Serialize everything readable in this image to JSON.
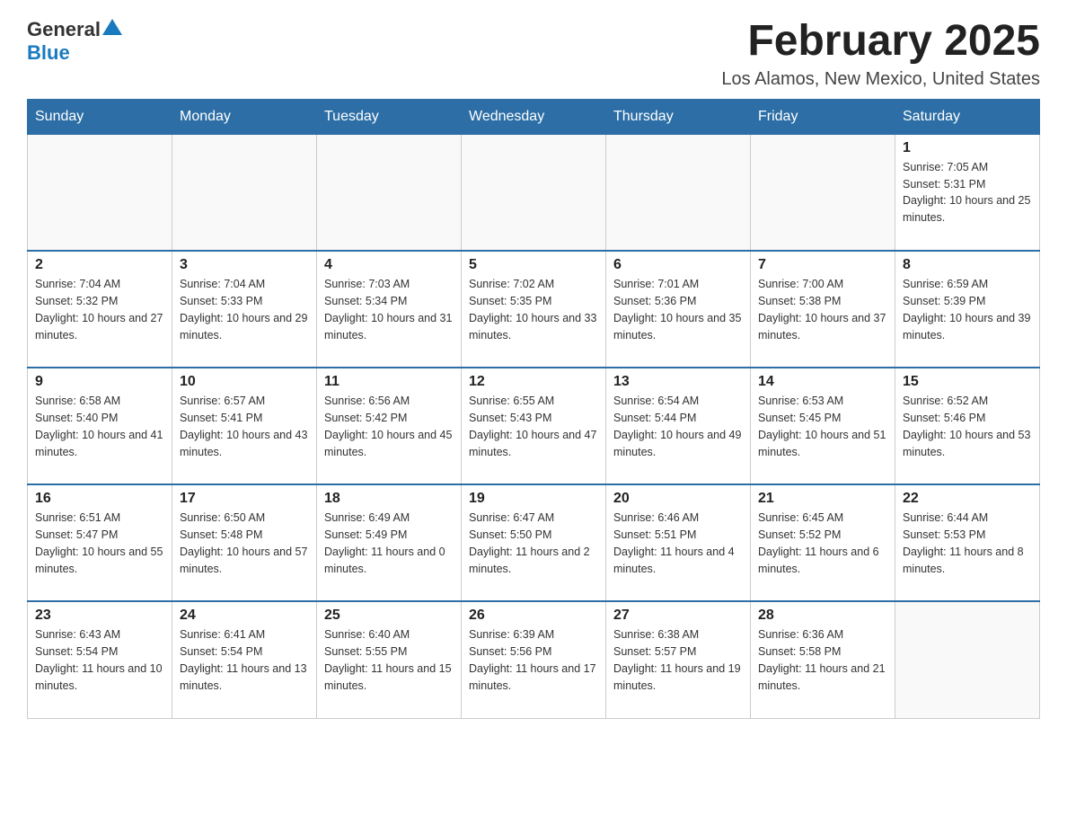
{
  "header": {
    "logo_general": "General",
    "logo_blue": "Blue",
    "month_title": "February 2025",
    "location": "Los Alamos, New Mexico, United States"
  },
  "days_of_week": [
    "Sunday",
    "Monday",
    "Tuesday",
    "Wednesday",
    "Thursday",
    "Friday",
    "Saturday"
  ],
  "weeks": [
    [
      {
        "day": "",
        "info": ""
      },
      {
        "day": "",
        "info": ""
      },
      {
        "day": "",
        "info": ""
      },
      {
        "day": "",
        "info": ""
      },
      {
        "day": "",
        "info": ""
      },
      {
        "day": "",
        "info": ""
      },
      {
        "day": "1",
        "info": "Sunrise: 7:05 AM\nSunset: 5:31 PM\nDaylight: 10 hours and 25 minutes."
      }
    ],
    [
      {
        "day": "2",
        "info": "Sunrise: 7:04 AM\nSunset: 5:32 PM\nDaylight: 10 hours and 27 minutes."
      },
      {
        "day": "3",
        "info": "Sunrise: 7:04 AM\nSunset: 5:33 PM\nDaylight: 10 hours and 29 minutes."
      },
      {
        "day": "4",
        "info": "Sunrise: 7:03 AM\nSunset: 5:34 PM\nDaylight: 10 hours and 31 minutes."
      },
      {
        "day": "5",
        "info": "Sunrise: 7:02 AM\nSunset: 5:35 PM\nDaylight: 10 hours and 33 minutes."
      },
      {
        "day": "6",
        "info": "Sunrise: 7:01 AM\nSunset: 5:36 PM\nDaylight: 10 hours and 35 minutes."
      },
      {
        "day": "7",
        "info": "Sunrise: 7:00 AM\nSunset: 5:38 PM\nDaylight: 10 hours and 37 minutes."
      },
      {
        "day": "8",
        "info": "Sunrise: 6:59 AM\nSunset: 5:39 PM\nDaylight: 10 hours and 39 minutes."
      }
    ],
    [
      {
        "day": "9",
        "info": "Sunrise: 6:58 AM\nSunset: 5:40 PM\nDaylight: 10 hours and 41 minutes."
      },
      {
        "day": "10",
        "info": "Sunrise: 6:57 AM\nSunset: 5:41 PM\nDaylight: 10 hours and 43 minutes."
      },
      {
        "day": "11",
        "info": "Sunrise: 6:56 AM\nSunset: 5:42 PM\nDaylight: 10 hours and 45 minutes."
      },
      {
        "day": "12",
        "info": "Sunrise: 6:55 AM\nSunset: 5:43 PM\nDaylight: 10 hours and 47 minutes."
      },
      {
        "day": "13",
        "info": "Sunrise: 6:54 AM\nSunset: 5:44 PM\nDaylight: 10 hours and 49 minutes."
      },
      {
        "day": "14",
        "info": "Sunrise: 6:53 AM\nSunset: 5:45 PM\nDaylight: 10 hours and 51 minutes."
      },
      {
        "day": "15",
        "info": "Sunrise: 6:52 AM\nSunset: 5:46 PM\nDaylight: 10 hours and 53 minutes."
      }
    ],
    [
      {
        "day": "16",
        "info": "Sunrise: 6:51 AM\nSunset: 5:47 PM\nDaylight: 10 hours and 55 minutes."
      },
      {
        "day": "17",
        "info": "Sunrise: 6:50 AM\nSunset: 5:48 PM\nDaylight: 10 hours and 57 minutes."
      },
      {
        "day": "18",
        "info": "Sunrise: 6:49 AM\nSunset: 5:49 PM\nDaylight: 11 hours and 0 minutes."
      },
      {
        "day": "19",
        "info": "Sunrise: 6:47 AM\nSunset: 5:50 PM\nDaylight: 11 hours and 2 minutes."
      },
      {
        "day": "20",
        "info": "Sunrise: 6:46 AM\nSunset: 5:51 PM\nDaylight: 11 hours and 4 minutes."
      },
      {
        "day": "21",
        "info": "Sunrise: 6:45 AM\nSunset: 5:52 PM\nDaylight: 11 hours and 6 minutes."
      },
      {
        "day": "22",
        "info": "Sunrise: 6:44 AM\nSunset: 5:53 PM\nDaylight: 11 hours and 8 minutes."
      }
    ],
    [
      {
        "day": "23",
        "info": "Sunrise: 6:43 AM\nSunset: 5:54 PM\nDaylight: 11 hours and 10 minutes."
      },
      {
        "day": "24",
        "info": "Sunrise: 6:41 AM\nSunset: 5:54 PM\nDaylight: 11 hours and 13 minutes."
      },
      {
        "day": "25",
        "info": "Sunrise: 6:40 AM\nSunset: 5:55 PM\nDaylight: 11 hours and 15 minutes."
      },
      {
        "day": "26",
        "info": "Sunrise: 6:39 AM\nSunset: 5:56 PM\nDaylight: 11 hours and 17 minutes."
      },
      {
        "day": "27",
        "info": "Sunrise: 6:38 AM\nSunset: 5:57 PM\nDaylight: 11 hours and 19 minutes."
      },
      {
        "day": "28",
        "info": "Sunrise: 6:36 AM\nSunset: 5:58 PM\nDaylight: 11 hours and 21 minutes."
      },
      {
        "day": "",
        "info": ""
      }
    ]
  ]
}
